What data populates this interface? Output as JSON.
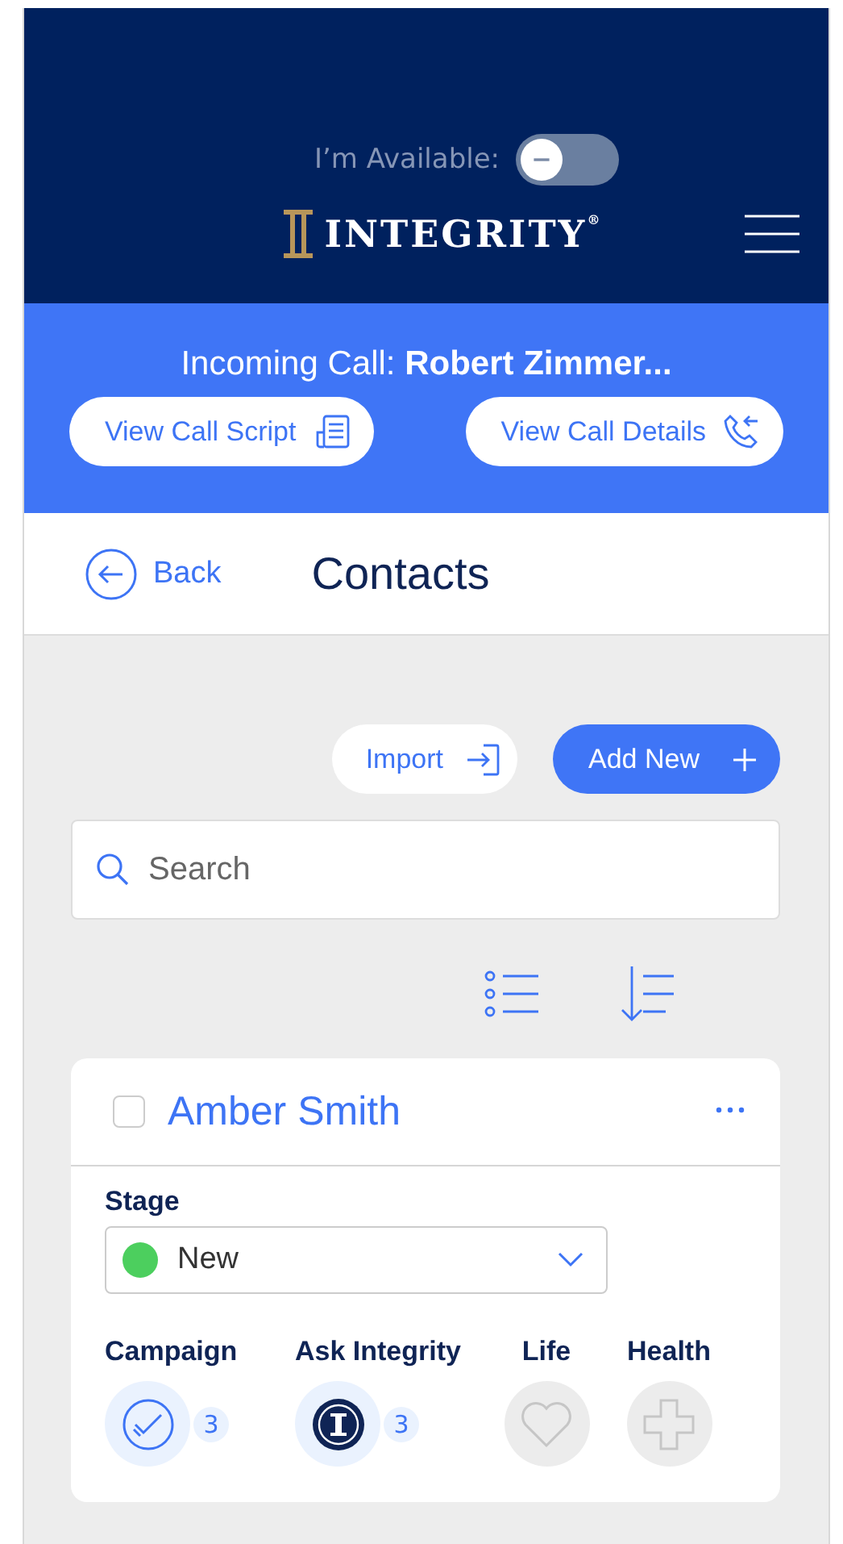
{
  "header": {
    "availability_label": "I’m Available:",
    "available": false,
    "logo_text": "INTEGRITY$^{®}$"
  },
  "incoming_call": {
    "label": "Incoming Call:",
    "caller": "Robert Zimmer...",
    "buttons": [
      {
        "label": "View Call Script",
        "kind": "script"
      },
      {
        "label": "View Call Details",
        "kind": "details"
      }
    ]
  },
  "nav": {
    "back": "Back",
    "title": "Contacts"
  },
  "actions": [
    {
      "label": "Import",
      "kind": "import"
    },
    {
      "label": "Add New",
      "kind": "add"
    }
  ],
  "search": {
    "placeholder": "Search"
  },
  "contacts": [
    {
      "name": "Amber Smith",
      "checked": false,
      "stage_label": "Stage",
      "stage": "New",
      "color": "#4ccf5e",
      "badges": [
        {
          "label": "Campaign",
          "kind": "campaign",
          "active": true,
          "count": "3"
        },
        {
          "label": "Ask Integrity",
          "kind": "ask",
          "active": true,
          "count": "3"
        },
        {
          "label": "Life",
          "kind": "life",
          "active": false
        },
        {
          "label": "Health",
          "kind": "health",
          "active": false
        }
      ]
    }
  ]
}
